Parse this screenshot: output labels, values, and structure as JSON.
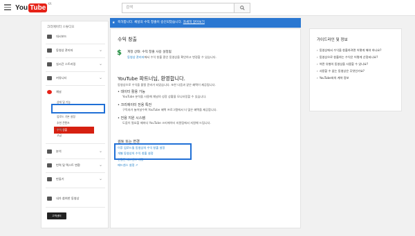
{
  "topbar": {
    "logo_you": "You",
    "logo_tube": "Tube",
    "logo_region": "KR",
    "search_placeholder": "검색"
  },
  "sidebar": {
    "title": "크리에이터 스튜디오",
    "items": [
      {
        "label": "대시보드",
        "icon": "dashboard-icon"
      },
      {
        "label": "동영상 관리자",
        "icon": "video-manager-icon"
      },
      {
        "label": "실시간 스트리밍",
        "icon": "live-icon"
      },
      {
        "label": "커뮤니티",
        "icon": "community-icon"
      },
      {
        "label": "채널",
        "icon": "channel-icon"
      }
    ],
    "channel_sub": [
      "상태 및 기능",
      "수익 창출",
      "업로드 기본 설정",
      "추천 콘텐츠",
      "브랜딩",
      "고급"
    ],
    "more_items": [
      {
        "label": "분석",
        "icon": "analytics-icon"
      },
      {
        "label": "번역 및 텍스트 변환",
        "icon": "translate-icon"
      },
      {
        "label": "만들기",
        "icon": "create-icon"
      },
      {
        "label": "내가 참여한 동영상",
        "icon": "contributions-icon"
      }
    ],
    "classic_button": "고객센터"
  },
  "banner": {
    "text": "축하합니다. 채널의 수익 창출이 승인되었습니다.",
    "link": "자세히 알아보기"
  },
  "main": {
    "section_title": "수익 창출",
    "account_status": "계정 상태: 수익 창출 사용 설정됨",
    "account_desc_link": "동영상 관리자",
    "account_desc": "에서 수익 창출 중인 동영상을 확인하고 변경할 수 있습니다.",
    "partner_title": "YouTube 파트너님, 환영합니다.",
    "partner_desc": "동영상으로 수익을 올릴 준비가 되었습니다. 또한 다음과 같은 혜택이 제공됩니다.",
    "benefits": [
      {
        "title": "데이터 활용 가능",
        "desc": "YouTube 분석을 사용해 채널의 성장 상황을 모니터링할 수 있습니다."
      },
      {
        "title": "크리에이터 전용 특전",
        "desc": "구독자가 늘어날수록 YouTube 혜택 프로그램에서 더 많은 혜택을 제공합니다."
      },
      {
        "title": "전용 지원 시스템",
        "desc": "도움이 필요할 때마다 YouTube 크리에이터 지원팀에서 지원해 드립니다."
      }
    ],
    "review_title": "검토 또는 변경",
    "review_links": [
      "이후 업로드될 동영상의 수익 창출 설정",
      "개별 동영상의 수익 창출 설정",
      "연결된 애드센스 계정",
      "애드센스 설정 ↗"
    ]
  },
  "right_panel": {
    "title": "가이드라인 및 정보",
    "items": [
      "동영상에서 수익을 창출하려면 어떻게 해야 하나요?",
      "동영상으로 창출하는 수익은 어떻게 산정되나요?",
      "어떤 유형의 동영상을 사용할 수 있나요?",
      "사용할 수 없는 동영상은 무엇인가요?",
      "YouTube와의 계약 정보"
    ]
  },
  "colors": {
    "brand_red": "#e62117",
    "banner_blue": "#2a77d1",
    "highlight_blue": "#1f6fd6",
    "link_blue": "#167ac6",
    "money_green": "#1b8a3a"
  }
}
